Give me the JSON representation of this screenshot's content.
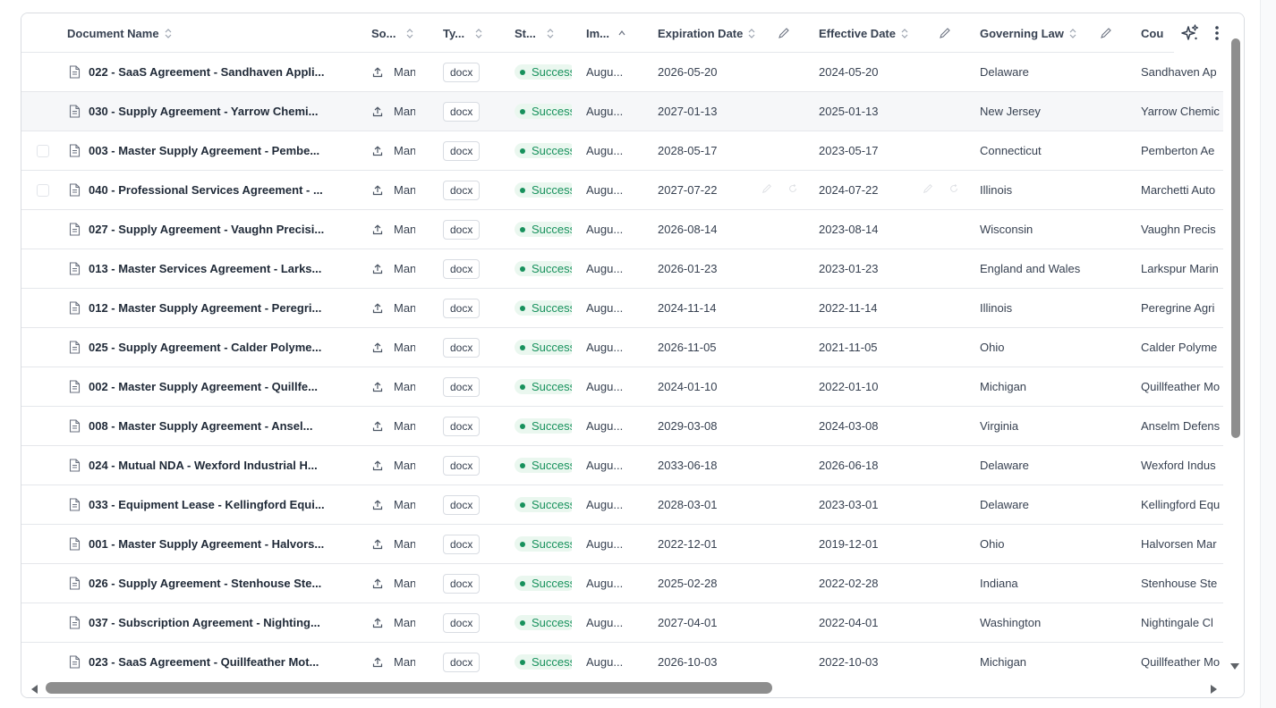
{
  "columns": {
    "document_name": "Document Name",
    "source": "So...",
    "type": "Ty...",
    "status": "St...",
    "imported": "Im...",
    "expiration_date": "Expiration Date",
    "effective_date": "Effective Date",
    "governing_law": "Governing Law",
    "counterparty": "Cou"
  },
  "icons": {
    "doc": "file-text-icon",
    "upload": "upload-icon",
    "sort": "sort-icon",
    "edit": "pencil-icon",
    "ai": "sparkles-icon",
    "menu": "more-vertical-icon"
  },
  "colors": {
    "status_green": "#17915c",
    "status_bg": "#eaf7ef",
    "scrollbar": "#8e8e8e"
  },
  "rows": [
    {
      "name": "022 - SaaS Agreement - Sandhaven Appli...",
      "source": "Manual",
      "type": "docx",
      "status": "Success",
      "imported": "Augu...",
      "expiration": "2026-05-20",
      "effective": "2024-05-20",
      "law": "Delaware",
      "counterparty": "Sandhaven Ap"
    },
    {
      "name": "030 - Supply Agreement - Yarrow Chemi...",
      "source": "Manual",
      "type": "docx",
      "status": "Success",
      "imported": "Augu...",
      "expiration": "2027-01-13",
      "effective": "2025-01-13",
      "law": "New Jersey",
      "counterparty": "Yarrow Chemic"
    },
    {
      "name": "003 - Master Supply Agreement - Pembe...",
      "source": "Manual",
      "type": "docx",
      "status": "Success",
      "imported": "Augu...",
      "expiration": "2028-05-17",
      "effective": "2023-05-17",
      "law": "Connecticut",
      "counterparty": "Pemberton Ae"
    },
    {
      "name": "040 - Professional Services Agreement - ...",
      "source": "Manual",
      "type": "docx",
      "status": "Success",
      "imported": "Augu...",
      "expiration": "2027-07-22",
      "effective": "2024-07-22",
      "law": "Illinois",
      "counterparty": "Marchetti Auto"
    },
    {
      "name": "027 - Supply Agreement - Vaughn Precisi...",
      "source": "Manual",
      "type": "docx",
      "status": "Success",
      "imported": "Augu...",
      "expiration": "2026-08-14",
      "effective": "2023-08-14",
      "law": "Wisconsin",
      "counterparty": "Vaughn Precis"
    },
    {
      "name": "013 - Master Services Agreement - Larks...",
      "source": "Manual",
      "type": "docx",
      "status": "Success",
      "imported": "Augu...",
      "expiration": "2026-01-23",
      "effective": "2023-01-23",
      "law": "England and Wales",
      "counterparty": "Larkspur Marin"
    },
    {
      "name": "012 - Master Supply Agreement - Peregri...",
      "source": "Manual",
      "type": "docx",
      "status": "Success",
      "imported": "Augu...",
      "expiration": "2024-11-14",
      "effective": "2022-11-14",
      "law": "Illinois",
      "counterparty": "Peregrine Agri"
    },
    {
      "name": "025 - Supply Agreement - Calder Polyme...",
      "source": "Manual",
      "type": "docx",
      "status": "Success",
      "imported": "Augu...",
      "expiration": "2026-11-05",
      "effective": "2021-11-05",
      "law": "Ohio",
      "counterparty": "Calder Polyme"
    },
    {
      "name": "002 - Master Supply Agreement - Quillfe...",
      "source": "Manual",
      "type": "docx",
      "status": "Success",
      "imported": "Augu...",
      "expiration": "2024-01-10",
      "effective": "2022-01-10",
      "law": "Michigan",
      "counterparty": "Quillfeather Mo"
    },
    {
      "name": "008 - Master Supply Agreement - Ansel...",
      "source": "Manual",
      "type": "docx",
      "status": "Success",
      "imported": "Augu...",
      "expiration": "2029-03-08",
      "effective": "2024-03-08",
      "law": "Virginia",
      "counterparty": "Anselm Defens"
    },
    {
      "name": "024 - Mutual NDA - Wexford Industrial H...",
      "source": "Manual",
      "type": "docx",
      "status": "Success",
      "imported": "Augu...",
      "expiration": "2033-06-18",
      "effective": "2026-06-18",
      "law": "Delaware",
      "counterparty": "Wexford Indus"
    },
    {
      "name": "033 - Equipment Lease - Kellingford Equi...",
      "source": "Manual",
      "type": "docx",
      "status": "Success",
      "imported": "Augu...",
      "expiration": "2028-03-01",
      "effective": "2023-03-01",
      "law": "Delaware",
      "counterparty": "Kellingford Equ"
    },
    {
      "name": "001 - Master Supply Agreement - Halvors...",
      "source": "Manual",
      "type": "docx",
      "status": "Success",
      "imported": "Augu...",
      "expiration": "2022-12-01",
      "effective": "2019-12-01",
      "law": "Ohio",
      "counterparty": "Halvorsen Mar"
    },
    {
      "name": "026 - Supply Agreement - Stenhouse Ste...",
      "source": "Manual",
      "type": "docx",
      "status": "Success",
      "imported": "Augu...",
      "expiration": "2025-02-28",
      "effective": "2022-02-28",
      "law": "Indiana",
      "counterparty": "Stenhouse Ste"
    },
    {
      "name": "037 - Subscription Agreement - Nighting...",
      "source": "Manual",
      "type": "docx",
      "status": "Success",
      "imported": "Augu...",
      "expiration": "2027-04-01",
      "effective": "2022-04-01",
      "law": "Washington",
      "counterparty": "Nightingale Cl"
    },
    {
      "name": "023 - SaaS Agreement - Quillfeather Mot...",
      "source": "Manual",
      "type": "docx",
      "status": "Success",
      "imported": "Augu...",
      "expiration": "2026-10-03",
      "effective": "2022-10-03",
      "law": "Michigan",
      "counterparty": "Quillfeather Mo"
    }
  ]
}
